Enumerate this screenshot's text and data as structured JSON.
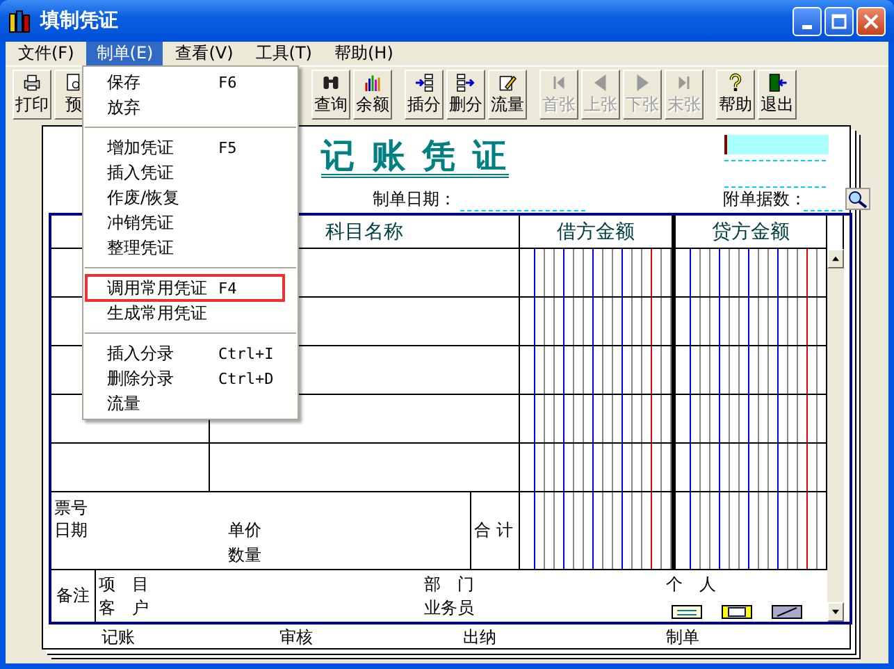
{
  "window": {
    "title": "填制凭证"
  },
  "menubar": [
    {
      "label": "文件(F)",
      "selected": false
    },
    {
      "label": "制单(E)",
      "selected": true
    },
    {
      "label": "查看(V)",
      "selected": false
    },
    {
      "label": "工具(T)",
      "selected": false
    },
    {
      "label": "帮助(H)",
      "selected": false
    }
  ],
  "toolbar": [
    {
      "buttons": [
        {
          "label": "打印",
          "disabled": false
        },
        {
          "label": "预",
          "disabled": false
        }
      ]
    },
    {
      "buttons": [
        {
          "label": "查询",
          "disabled": false
        },
        {
          "label": "余额",
          "disabled": false
        }
      ]
    },
    {
      "buttons": [
        {
          "label": "插分",
          "disabled": false
        },
        {
          "label": "删分",
          "disabled": false
        },
        {
          "label": "流量",
          "disabled": false
        }
      ]
    },
    {
      "buttons": [
        {
          "label": "首张",
          "disabled": true
        },
        {
          "label": "上张",
          "disabled": true
        },
        {
          "label": "下张",
          "disabled": true
        },
        {
          "label": "末张",
          "disabled": true
        }
      ]
    },
    {
      "buttons": [
        {
          "label": "帮助",
          "disabled": false
        },
        {
          "label": "退出",
          "disabled": false
        }
      ]
    }
  ],
  "menu": {
    "groups": [
      [
        {
          "label": "保存",
          "shortcut": "F6",
          "highlighted": false
        },
        {
          "label": "放弃",
          "highlighted": false
        }
      ],
      [
        {
          "label": "增加凭证",
          "shortcut": "F5",
          "highlighted": false
        },
        {
          "label": "插入凭证",
          "highlighted": false
        },
        {
          "label": "作废/恢复",
          "highlighted": false
        },
        {
          "label": "冲销凭证",
          "highlighted": false
        },
        {
          "label": "整理凭证",
          "highlighted": false
        }
      ],
      [
        {
          "label": "调用常用凭证",
          "shortcut": "F4",
          "highlighted": true
        },
        {
          "label": "生成常用凭证",
          "highlighted": false
        }
      ],
      [
        {
          "label": "插入分录",
          "shortcut": "Ctrl+I",
          "highlighted": false
        },
        {
          "label": "删除分录",
          "shortcut": "Ctrl+D",
          "highlighted": false
        },
        {
          "label": "流量",
          "highlighted": false
        }
      ]
    ]
  },
  "voucher": {
    "title": "记 账 凭 证",
    "date_label": "制单日期：",
    "attachments_label": "附单据数：",
    "columns": [
      "科目名称",
      "借方金额",
      "贷方金额"
    ],
    "totals": {
      "ticket_label": "票号",
      "date_label": "日期",
      "unit_price_label": "单价",
      "quantity_label": "数量",
      "total_label": "合 计"
    },
    "remarks": {
      "label": "备注",
      "project_label": "项　目",
      "customer_label": "客　户",
      "department_label": "部　门",
      "salesperson_label": "业务员",
      "individual_label": "个　人"
    },
    "signatures": [
      "记账",
      "审核",
      "出纳",
      "制单"
    ]
  }
}
